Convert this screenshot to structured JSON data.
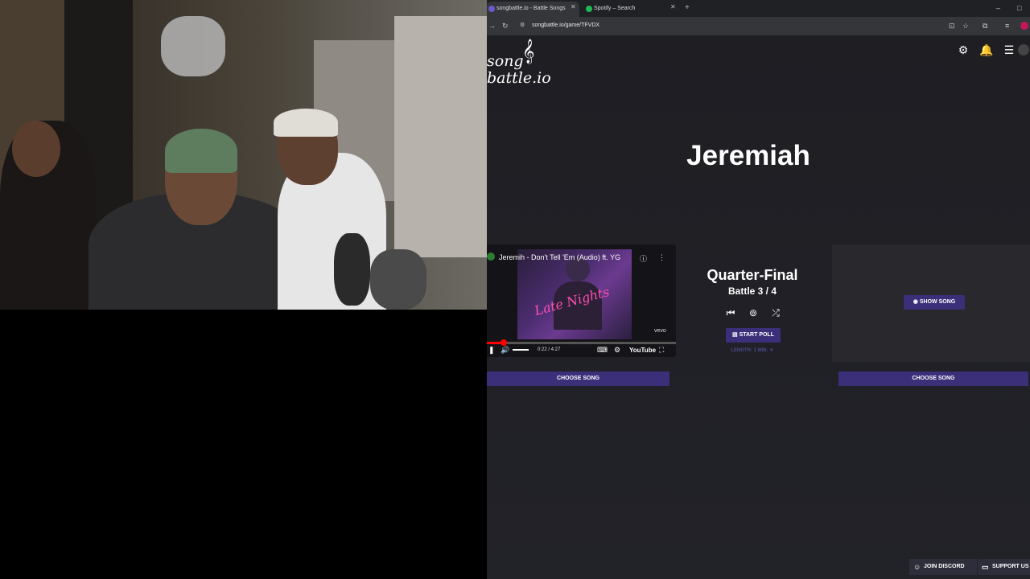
{
  "browser": {
    "tabs": [
      {
        "label": "songbattle.io - Battle Songs",
        "active": true
      },
      {
        "label": "Spotify – Search",
        "active": false
      }
    ],
    "url": "songbattle.io/game/TFVDX"
  },
  "site": {
    "logo_line1": "song",
    "logo_line2": "battle.io",
    "title": "Jeremiah"
  },
  "video": {
    "title": "Jeremih - Don't Tell 'Em (Audio) ft. YG",
    "watermark": "vevo",
    "time": "0:22 / 4:27",
    "progress": 0.09,
    "brand": "YouTube"
  },
  "battle": {
    "round": "Quarter-Final",
    "number": "Battle 3 / 4",
    "start_poll": "START POLL",
    "length": "LENGTH: 1 MIN. ▼",
    "choose_left": "CHOOSE SONG",
    "choose_right": "CHOOSE SONG",
    "show_song": "SHOW SONG"
  },
  "footer": {
    "discord": "JOIN DISCORD",
    "support": "SUPPORT US"
  },
  "colors": {
    "accent": "#3b2f7a",
    "background": "#1f1f24"
  }
}
